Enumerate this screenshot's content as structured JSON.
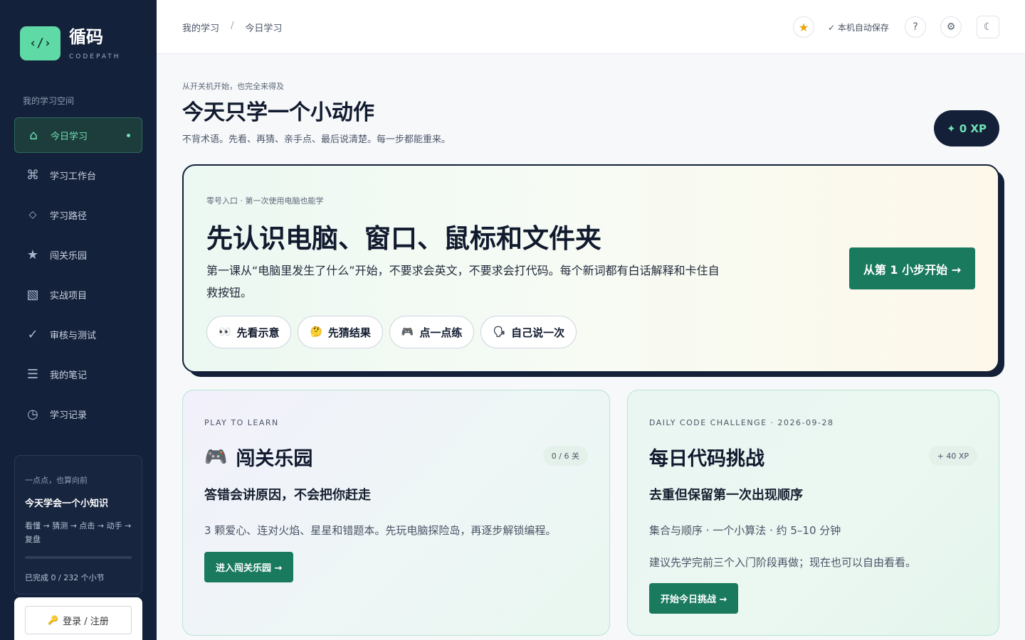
{
  "brand": {
    "logo_glyph": "‹/›",
    "title": "循码",
    "subtitle": "CODEPATH",
    "accent": "#5fd9a6"
  },
  "sidebar": {
    "section_label": "我的学习空间",
    "items": [
      {
        "label": "今日学习",
        "icon": "home-icon",
        "glyph": "⌂"
      },
      {
        "label": "学习工作台",
        "icon": "command-icon",
        "glyph": "⌘"
      },
      {
        "label": "学习路径",
        "icon": "diamond-icon",
        "glyph": "◇"
      },
      {
        "label": "闯关乐园",
        "icon": "star-icon",
        "glyph": "★"
      },
      {
        "label": "实战项目",
        "icon": "hatched-square-icon",
        "glyph": "▧"
      },
      {
        "label": "审核与测试",
        "icon": "check-icon",
        "glyph": "✓"
      },
      {
        "label": "我的笔记",
        "icon": "list-icon",
        "glyph": "☰"
      },
      {
        "label": "学习记录",
        "icon": "clock-icon",
        "glyph": "◷"
      }
    ],
    "progress_card": {
      "kicker": "一点点，也算向前",
      "title": "今天学会一个小知识",
      "steps": "看懂 → 猜测 → 点击 → 动手 → 复盘",
      "progress": 0,
      "done_text": "已完成 0 / 232 个小节"
    },
    "login": {
      "icon": "key-icon",
      "glyph": "🔑",
      "label": "登录 / 注册"
    }
  },
  "topbar": {
    "breadcrumb": [
      "我的学习",
      "今日学习"
    ],
    "breadcrumb_sep": "/",
    "star_glyph": "★",
    "autosave": "✓ 本机自动保存",
    "help_glyph": "?",
    "gear_glyph": "⚙",
    "moon_glyph": "☾"
  },
  "hero": {
    "kicker": "从开关机开始，也完全来得及",
    "title": "今天只学一个小动作",
    "subtitle": "不背术语。先看、再猜、亲手点、最后说清楚。每一步都能重来。",
    "xp": "✦ 0 XP"
  },
  "intro": {
    "kicker": "零号入口 · 第一次使用电脑也能学",
    "title": "先认识电脑、窗口、鼠标和文件夹",
    "desc": "第一课从“电脑里发生了什么”开始，不要求会英文，不要求会打代码。每个新词都有白话解释和卡住自救按钮。",
    "chips": [
      {
        "icon": "👀",
        "label": "先看示意"
      },
      {
        "icon": "🤔",
        "label": "先猜结果"
      },
      {
        "icon": "🎮",
        "label": "点一点练"
      },
      {
        "icon": "🗣",
        "label": "自己说一次"
      }
    ],
    "cta": "从第 1 小步开始 →"
  },
  "play": {
    "kicker": "PLAY TO LEARN",
    "icon": "🎮",
    "title": "闯关乐园",
    "badge": "0 / 6 关",
    "subtitle": "答错会讲原因，不会把你赶走",
    "text": "3 颗爱心、连对火焰、星星和错题本。先玩电脑探险岛，再逐步解锁编程。",
    "button": "进入闯关乐园 →"
  },
  "daily": {
    "kicker": "DAILY CODE CHALLENGE · 2026-09-28",
    "title": "每日代码挑战",
    "badge": "+ 40 XP",
    "subtitle": "去重但保留第一次出现顺序",
    "meta": "集合与顺序 · 一个小算法 · 约 5–10 分钟",
    "note": "建议先学完前三个入门阶段再做；现在也可以自由看看。",
    "button": "开始今日挑战 →"
  }
}
